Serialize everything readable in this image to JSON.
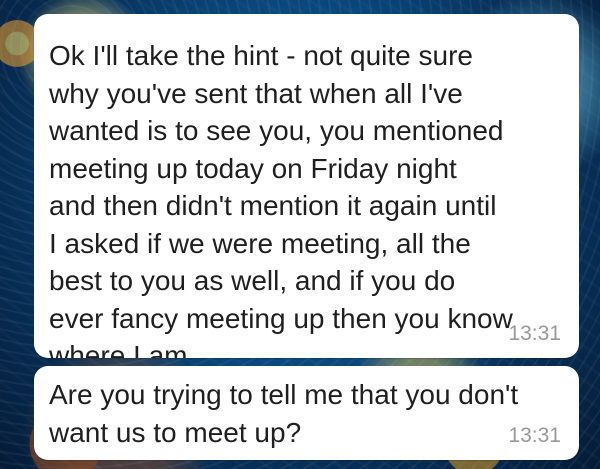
{
  "theme": {
    "bubble_color": "#ffffff",
    "text_color": "#1f1f1f",
    "timestamp_color": "#999999",
    "wallpaper_primary": "#0a4e86"
  },
  "conversation": {
    "messages": [
      {
        "text": "Ok I'll take the hint - not quite sure\nwhy you've sent that when all I've\nwanted is to see you, you mentioned\nmeeting up today on Friday night\nand then didn't mention it again until\nI asked if we were meeting, all the\nbest to you as well, and if you do\never fancy meeting up then you know\nwhere I am",
        "time": "13:31"
      },
      {
        "text": "Are you trying to tell me that you don't\nwant us to meet up?",
        "time": "13:31"
      }
    ]
  }
}
